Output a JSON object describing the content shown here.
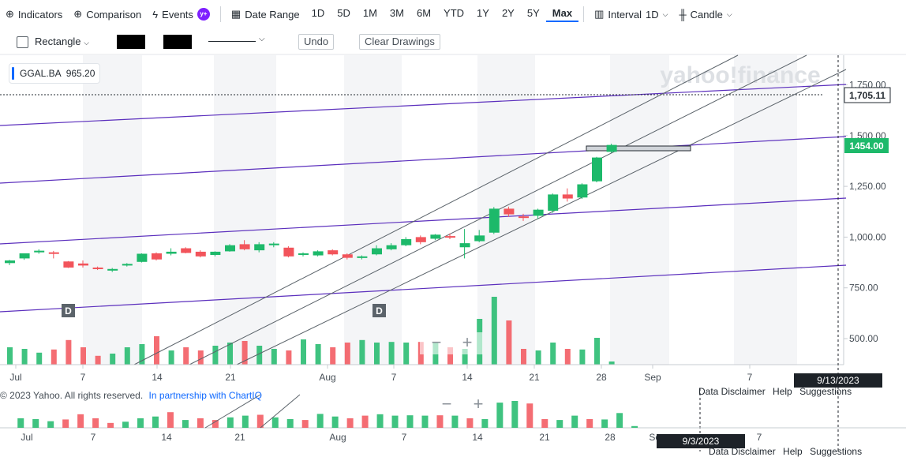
{
  "toolbar": {
    "indicators": "Indicators",
    "comparison": "Comparison",
    "events": "Events",
    "events_badge": "y+",
    "date_range": "Date Range",
    "ranges": [
      "1D",
      "5D",
      "1M",
      "3M",
      "6M",
      "YTD",
      "1Y",
      "2Y",
      "5Y",
      "Max"
    ],
    "active_range": "Max",
    "interval_label": "Interval",
    "interval_value": "1D",
    "chart_type": "Candle"
  },
  "drawing": {
    "shape": "Rectangle",
    "undo": "Undo",
    "clear": "Clear Drawings"
  },
  "symbol": {
    "ticker": "GGAL.BA",
    "value": "965.20"
  },
  "watermark": "yahoo!finance",
  "price_labels": {
    "dashed": "1,705.11",
    "last": "1454.00"
  },
  "date_labels": {
    "crosshair": "9/13/2023",
    "nav_crosshair": "9/3/2023"
  },
  "footer": {
    "copyright": "© 2023 Yahoo. All rights reserved.",
    "partner": "In partnership with ChartIQ"
  },
  "links": [
    "Data Disclaimer",
    "Help",
    "Suggestions"
  ],
  "event_markers": [
    "D",
    "D"
  ],
  "zoom": {
    "minus": "−",
    "plus": "+"
  },
  "colors": {
    "up": "#1db96a",
    "down": "#f2545b",
    "accent": "#0f69ff",
    "channel": "#5b2fbd"
  },
  "chart_data": {
    "type": "candlestick",
    "title": "",
    "y_axis_ticks": [
      500,
      750,
      1000,
      1250,
      1500,
      1750
    ],
    "y_axis_labels": [
      "500.00",
      "750.00",
      "1,000.00",
      "1,250.00",
      "1,500.00",
      "1,750.00"
    ],
    "ylim": [
      420,
      1950
    ],
    "x_axis_ticks": [
      {
        "label": "Jul",
        "date": "2023-07-03"
      },
      {
        "label": "7",
        "date": "2023-07-07"
      },
      {
        "label": "14",
        "date": "2023-07-14"
      },
      {
        "label": "21",
        "date": "2023-07-21"
      },
      {
        "label": "Aug",
        "date": "2023-08-01"
      },
      {
        "label": "7",
        "date": "2023-08-07"
      },
      {
        "label": "14",
        "date": "2023-08-14"
      },
      {
        "label": "21",
        "date": "2023-08-21"
      },
      {
        "label": "28",
        "date": "2023-08-28"
      },
      {
        "label": "Sep",
        "date": "2023-09-01"
      },
      {
        "label": "7",
        "date": "2023-09-07"
      }
    ],
    "nav_x_axis_ticks": [
      "Jul",
      "7",
      "14",
      "21",
      "Aug",
      "7",
      "14",
      "21",
      "28",
      "Sep",
      "7"
    ],
    "candles": [
      {
        "date": "2023-07-03",
        "o": 872,
        "h": 888,
        "l": 862,
        "c": 885
      },
      {
        "date": "2023-07-04",
        "o": 895,
        "h": 920,
        "l": 888,
        "c": 920
      },
      {
        "date": "2023-07-05",
        "o": 925,
        "h": 940,
        "l": 918,
        "c": 933
      },
      {
        "date": "2023-07-06",
        "o": 925,
        "h": 932,
        "l": 895,
        "c": 918
      },
      {
        "date": "2023-07-07",
        "o": 880,
        "h": 882,
        "l": 848,
        "c": 850
      },
      {
        "date": "2023-07-10",
        "o": 870,
        "h": 885,
        "l": 850,
        "c": 860
      },
      {
        "date": "2023-07-11",
        "o": 850,
        "h": 855,
        "l": 838,
        "c": 843
      },
      {
        "date": "2023-07-12",
        "o": 835,
        "h": 848,
        "l": 828,
        "c": 843
      },
      {
        "date": "2023-07-13",
        "o": 860,
        "h": 872,
        "l": 855,
        "c": 868
      },
      {
        "date": "2023-07-14",
        "o": 878,
        "h": 920,
        "l": 875,
        "c": 918
      },
      {
        "date": "2023-07-17",
        "o": 920,
        "h": 925,
        "l": 885,
        "c": 890
      },
      {
        "date": "2023-07-18",
        "o": 918,
        "h": 945,
        "l": 910,
        "c": 928
      },
      {
        "date": "2023-07-19",
        "o": 945,
        "h": 950,
        "l": 920,
        "c": 922
      },
      {
        "date": "2023-07-20",
        "o": 928,
        "h": 935,
        "l": 900,
        "c": 905
      },
      {
        "date": "2023-07-21",
        "o": 912,
        "h": 930,
        "l": 905,
        "c": 928
      },
      {
        "date": "2023-07-24",
        "o": 930,
        "h": 965,
        "l": 928,
        "c": 960
      },
      {
        "date": "2023-07-25",
        "o": 965,
        "h": 985,
        "l": 935,
        "c": 940
      },
      {
        "date": "2023-07-26",
        "o": 935,
        "h": 975,
        "l": 925,
        "c": 965
      },
      {
        "date": "2023-07-27",
        "o": 960,
        "h": 975,
        "l": 950,
        "c": 968
      },
      {
        "date": "2023-07-28",
        "o": 948,
        "h": 955,
        "l": 900,
        "c": 905
      },
      {
        "date": "2023-07-31",
        "o": 915,
        "h": 925,
        "l": 905,
        "c": 920
      },
      {
        "date": "2023-08-01",
        "o": 910,
        "h": 935,
        "l": 905,
        "c": 930
      },
      {
        "date": "2023-08-02",
        "o": 935,
        "h": 940,
        "l": 910,
        "c": 915
      },
      {
        "date": "2023-08-03",
        "o": 915,
        "h": 920,
        "l": 890,
        "c": 898
      },
      {
        "date": "2023-08-04",
        "o": 900,
        "h": 910,
        "l": 890,
        "c": 905
      },
      {
        "date": "2023-08-07",
        "o": 915,
        "h": 960,
        "l": 910,
        "c": 945
      },
      {
        "date": "2023-08-08",
        "o": 940,
        "h": 970,
        "l": 935,
        "c": 960
      },
      {
        "date": "2023-08-09",
        "o": 960,
        "h": 1000,
        "l": 955,
        "c": 990
      },
      {
        "date": "2023-08-10",
        "o": 1000,
        "h": 1008,
        "l": 965,
        "c": 975
      },
      {
        "date": "2023-08-11",
        "o": 992,
        "h": 1015,
        "l": 985,
        "c": 1012
      },
      {
        "date": "2023-08-14",
        "o": 1005,
        "h": 1018,
        "l": 990,
        "c": 998
      },
      {
        "date": "2023-08-15",
        "o": 950,
        "h": 1040,
        "l": 895,
        "c": 970
      },
      {
        "date": "2023-08-16",
        "o": 980,
        "h": 1035,
        "l": 975,
        "c": 1008
      },
      {
        "date": "2023-08-17",
        "o": 1022,
        "h": 1148,
        "l": 1015,
        "c": 1140
      },
      {
        "date": "2023-08-18",
        "o": 1140,
        "h": 1150,
        "l": 1100,
        "c": 1112
      },
      {
        "date": "2023-08-21",
        "o": 1102,
        "h": 1115,
        "l": 1080,
        "c": 1095
      },
      {
        "date": "2023-08-22",
        "o": 1105,
        "h": 1140,
        "l": 1090,
        "c": 1135
      },
      {
        "date": "2023-08-23",
        "o": 1130,
        "h": 1215,
        "l": 1120,
        "c": 1210
      },
      {
        "date": "2023-08-24",
        "o": 1210,
        "h": 1240,
        "l": 1175,
        "c": 1190
      },
      {
        "date": "2023-08-25",
        "o": 1195,
        "h": 1265,
        "l": 1188,
        "c": 1260
      },
      {
        "date": "2023-08-28",
        "o": 1275,
        "h": 1395,
        "l": 1270,
        "c": 1392
      },
      {
        "date": "2023-08-29",
        "o": 1420,
        "h": 1460,
        "l": 1415,
        "c": 1454
      }
    ],
    "volume_relative": [
      0.55,
      0.5,
      0.38,
      0.48,
      0.78,
      0.55,
      0.28,
      0.35,
      0.55,
      0.65,
      0.9,
      0.45,
      0.55,
      0.45,
      0.6,
      0.7,
      0.75,
      0.6,
      0.5,
      0.45,
      0.8,
      0.65,
      0.55,
      0.7,
      0.78,
      0.7,
      0.72,
      0.7,
      0.72,
      0.7,
      0.55,
      0.5,
      1.45,
      2.15,
      1.4,
      0.5,
      0.45,
      0.7,
      0.5,
      0.48,
      0.85,
      0.1
    ]
  }
}
